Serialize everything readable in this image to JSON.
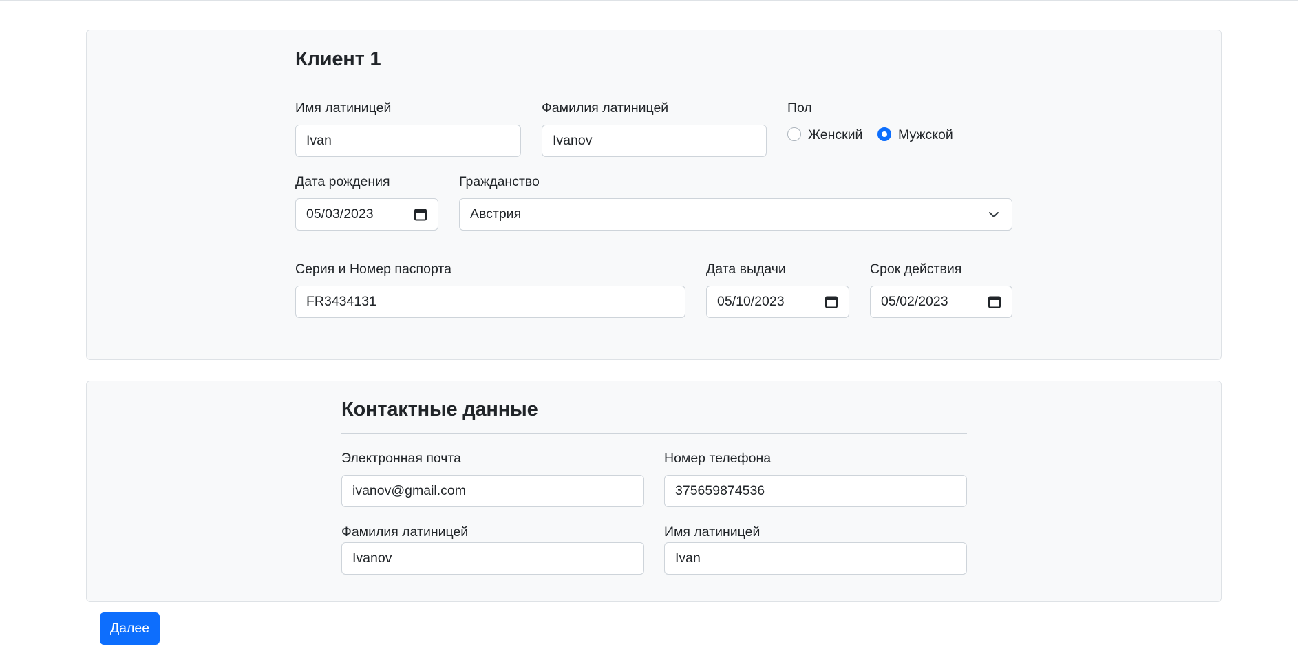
{
  "client": {
    "title": "Клиент 1",
    "first_name": {
      "label": "Имя латиницей",
      "value": "Ivan"
    },
    "last_name": {
      "label": "Фамилия латиницей",
      "value": "Ivanov"
    },
    "gender": {
      "label": "Пол",
      "options": [
        {
          "label": "Женский",
          "selected": false
        },
        {
          "label": "Мужской",
          "selected": true
        }
      ]
    },
    "birth_date": {
      "label": "Дата рождения",
      "value": "05/03/2023"
    },
    "citizenship": {
      "label": "Гражданство",
      "value": "Австрия"
    },
    "passport": {
      "label": "Серия и Номер паспорта",
      "value": "FR3434131"
    },
    "issue_date": {
      "label": "Дата выдачи",
      "value": "05/10/2023"
    },
    "expiry_date": {
      "label": "Срок действия",
      "value": "05/02/2023"
    }
  },
  "contacts": {
    "title": "Контактные данные",
    "email": {
      "label": "Электронная почта",
      "value": "ivanov@gmail.com"
    },
    "phone": {
      "label": "Номер телефона",
      "value": "375659874536"
    },
    "last_name": {
      "label": "Фамилия латиницей",
      "value": "Ivanov"
    },
    "first_name": {
      "label": "Имя латиницей",
      "value": "Ivan"
    }
  },
  "actions": {
    "next_label": "Далее"
  },
  "colors": {
    "accent": "#0d6efd",
    "card_bg": "#f8f9fa",
    "border": "#ced4da",
    "text": "#212529"
  },
  "icons": {
    "date": "calendar-icon",
    "select": "chevron-down-icon"
  }
}
